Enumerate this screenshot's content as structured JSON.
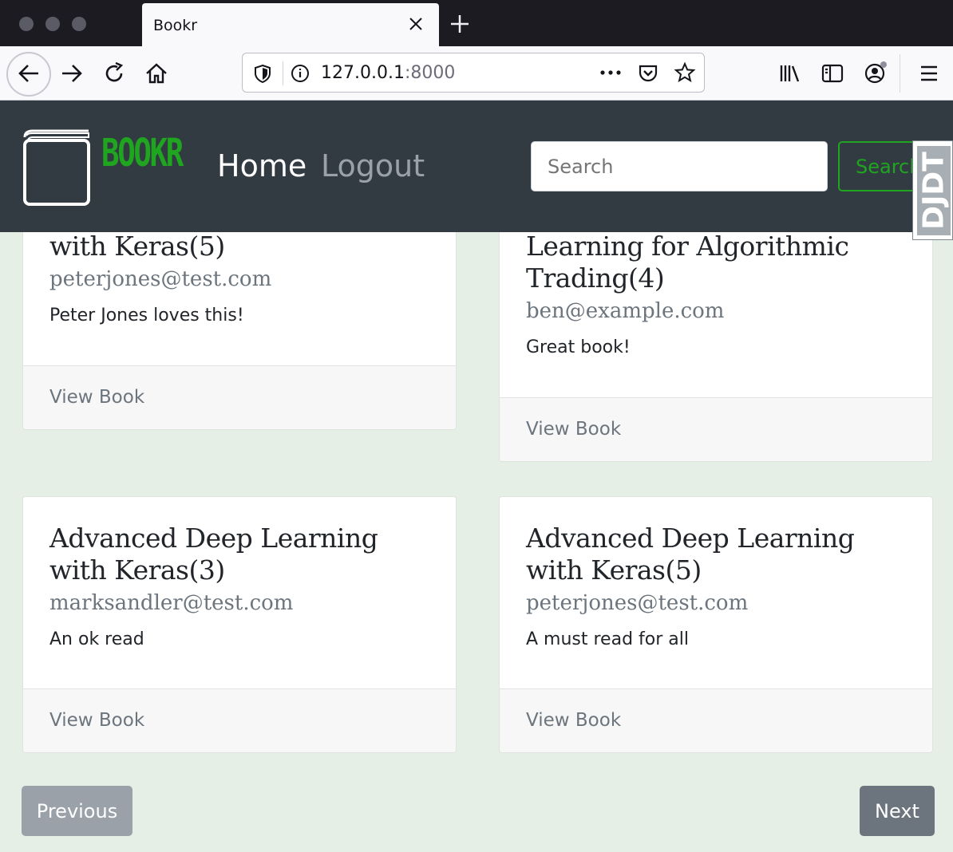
{
  "browser": {
    "tab_title": "Bookr",
    "url_host": "127.0.0.1",
    "url_port": ":8000"
  },
  "header": {
    "brand": "BOOKR",
    "nav": {
      "home": "Home",
      "logout": "Logout"
    },
    "search": {
      "placeholder": "Search",
      "button_label": "Search"
    },
    "debug_toolbar_label": "DJDT"
  },
  "cards": [
    {
      "title": "with Keras(5)",
      "email": "peterjones@test.com",
      "text": "Peter Jones loves this!",
      "link": "View Book"
    },
    {
      "title": "Learning for Algorithmic Trading(4)",
      "email": "ben@example.com",
      "text": "Great book!",
      "link": "View Book"
    },
    {
      "title": "Advanced Deep Learning with Keras(3)",
      "email": "marksandler@test.com",
      "text": "An ok read",
      "link": "View Book"
    },
    {
      "title": "Advanced Deep Learning with Keras(5)",
      "email": "peterjones@test.com",
      "text": "A must read for all",
      "link": "View Book"
    }
  ],
  "pagination": {
    "previous": "Previous",
    "next": "Next"
  }
}
